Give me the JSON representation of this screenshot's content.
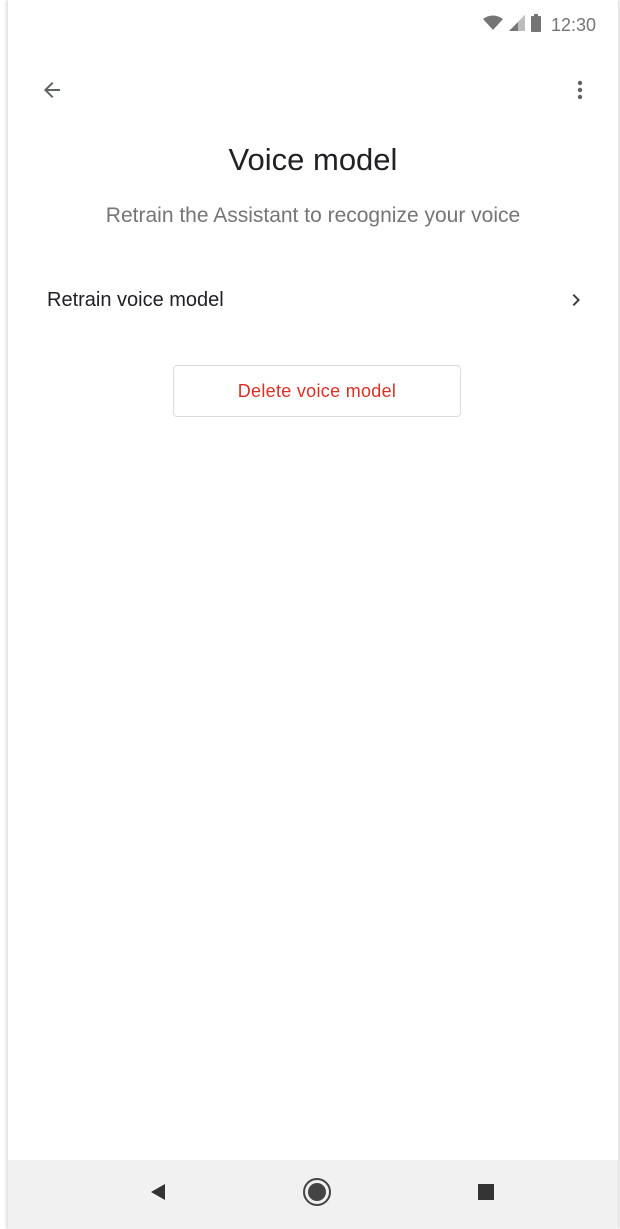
{
  "status_bar": {
    "time": "12:30",
    "icons": [
      "wifi-icon",
      "cell-signal-icon",
      "battery-icon"
    ]
  },
  "app_bar": {
    "back_icon": "arrow-back-icon",
    "more_icon": "more-vert-icon"
  },
  "page": {
    "title": "Voice model",
    "subtitle": "Retrain the Assistant to recognize your voice"
  },
  "settings": {
    "retrain_label": "Retrain voice model",
    "retrain_icon": "chevron-right-icon"
  },
  "actions": {
    "delete_label": "Delete voice model"
  },
  "nav_bar": {
    "icons": [
      "back-triangle-icon",
      "home-circle-icon",
      "recents-square-icon"
    ]
  },
  "colors": {
    "delete_text": "#d93025",
    "title_text": "#202124",
    "subtitle_text": "#757575",
    "nav_bar_bg": "#f1f1f1"
  }
}
